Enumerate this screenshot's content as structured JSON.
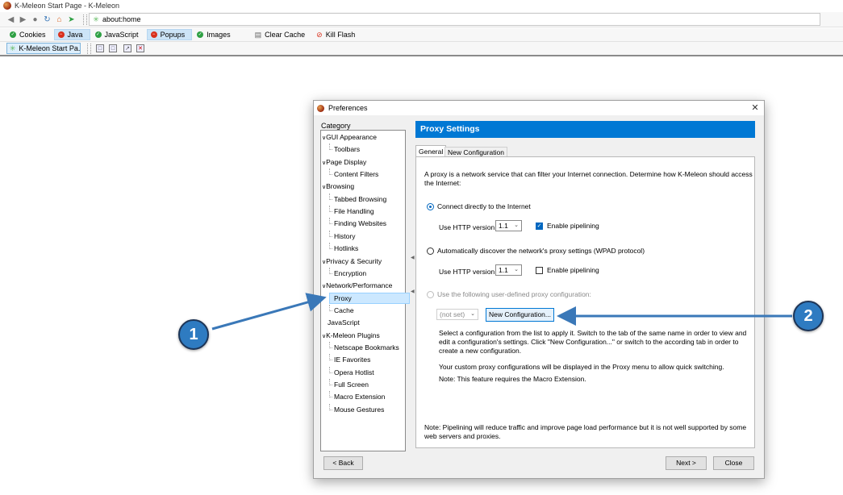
{
  "window": {
    "title": "K-Meleon Start Page - K-Meleon"
  },
  "navbar": {
    "url": "about:home"
  },
  "pluginbar": {
    "items": [
      {
        "label": "Cookies",
        "state": "on",
        "active": false
      },
      {
        "label": "Java",
        "state": "off",
        "active": true
      },
      {
        "label": "JavaScript",
        "state": "on",
        "active": false
      },
      {
        "label": "Popups",
        "state": "off",
        "active": true
      },
      {
        "label": "Images",
        "state": "on",
        "active": false
      },
      {
        "label": "Clear Cache",
        "state": "plain",
        "active": false
      },
      {
        "label": "Kill Flash",
        "state": "kill",
        "active": false
      }
    ]
  },
  "tabbar": {
    "tab_label": "K-Meleon Start Pa..."
  },
  "dialog": {
    "title": "Preferences",
    "category_label": "Category",
    "tree": [
      {
        "label": "GUI Appearance",
        "level": 0,
        "expanded": true
      },
      {
        "label": "Toolbars",
        "level": 1
      },
      {
        "label": "Page Display",
        "level": 0,
        "expanded": true
      },
      {
        "label": "Content Filters",
        "level": 1
      },
      {
        "label": "Browsing",
        "level": 0,
        "expanded": true
      },
      {
        "label": "Tabbed Browsing",
        "level": 1
      },
      {
        "label": "File Handling",
        "level": 1
      },
      {
        "label": "Finding Websites",
        "level": 1
      },
      {
        "label": "History",
        "level": 1
      },
      {
        "label": "Hotlinks",
        "level": 1
      },
      {
        "label": "Privacy & Security",
        "level": 0,
        "expanded": true
      },
      {
        "label": "Encryption",
        "level": 1
      },
      {
        "label": "Network/Performance",
        "level": 0,
        "expanded": true
      },
      {
        "label": "Proxy",
        "level": 1,
        "selected": true
      },
      {
        "label": "Cache",
        "level": 1
      },
      {
        "label": "JavaScript",
        "level": 0,
        "leaf": true
      },
      {
        "label": "K-Meleon Plugins",
        "level": 0,
        "expanded": true
      },
      {
        "label": "Netscape Bookmarks",
        "level": 1
      },
      {
        "label": "IE Favorites",
        "level": 1
      },
      {
        "label": "Opera Hotlist",
        "level": 1
      },
      {
        "label": "Full Screen",
        "level": 1
      },
      {
        "label": "Macro Extension",
        "level": 1
      },
      {
        "label": "Mouse Gestures",
        "level": 1
      }
    ],
    "panel": {
      "header": "Proxy Settings",
      "tabs": [
        "General",
        "New Configuration"
      ],
      "intro_line1": "A proxy is a network service that can filter your Internet connection. Determine how K-Meleon should access",
      "intro_line2": "the Internet:",
      "opt_direct": "Connect directly to the Internet",
      "opt_wpad": "Automatically discover the network's proxy settings (WPAD protocol)",
      "opt_user": "Use the following user-defined proxy configuration:",
      "http_label": "Use HTTP version",
      "http_value": "1.1",
      "pipelining_label": "Enable pipelining",
      "direct_pipelining_checked": true,
      "wpad_pipelining_checked": false,
      "config_select": "(not set)",
      "new_config_button": "New Configuration...",
      "help_line1": "Select a configuration from the list to apply it. Switch to the tab of the same name in order to view and",
      "help_line2": "edit a configuration's settings. Click \"New Configuration...\" or switch to the according tab in order to",
      "help_line3": "create a new configuration.",
      "custom_note": "Your custom proxy configurations will be displayed in the Proxy menu to allow quick switching.",
      "macro_note": "Note: This feature requires the Macro Extension.",
      "pipelining_note1": "Note: Pipelining will reduce traffic and improve page load performance but it is not well supported by some",
      "pipelining_note2": "web servers and proxies."
    },
    "buttons": {
      "back": "< Back",
      "next": "Next >",
      "close": "Close"
    }
  },
  "annotations": [
    {
      "label": "1"
    },
    {
      "label": "2"
    }
  ],
  "colors": {
    "accent": "#0078d4",
    "callout": "#2e7bc1",
    "arrow": "#3a78b8"
  }
}
